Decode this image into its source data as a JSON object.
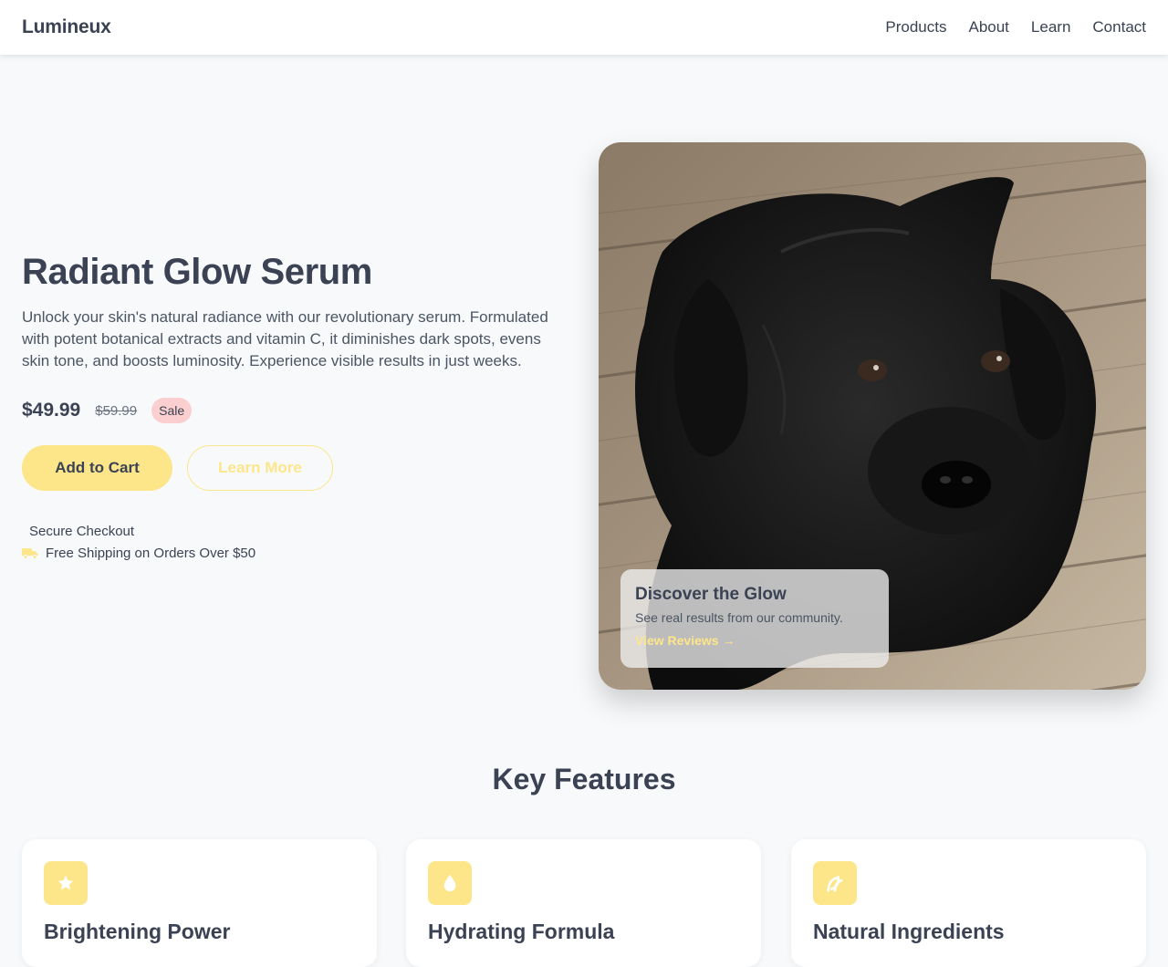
{
  "header": {
    "brand": "Lumineux",
    "nav": [
      "Products",
      "About",
      "Learn",
      "Contact"
    ]
  },
  "hero": {
    "title": "Radiant Glow Serum",
    "description": "Unlock your skin's natural radiance with our revolutionary serum. Formulated with potent botanical extracts and vitamin C, it diminishes dark spots, evens skin tone, and boosts luminosity. Experience visible results in just weeks.",
    "price": "$49.99",
    "old_price": "$59.99",
    "badge": "Sale",
    "add_to_cart": "Add to Cart",
    "learn_more": "Learn More",
    "perks": [
      "Secure Checkout",
      "Free Shipping on Orders Over $50"
    ],
    "image_overlay": {
      "title": "Discover the Glow",
      "text": "See real results from our community.",
      "link": "View Reviews →"
    }
  },
  "features": {
    "title": "Key Features",
    "items": [
      {
        "icon": "star-icon",
        "title": "Brightening Power"
      },
      {
        "icon": "droplet-icon",
        "title": "Hydrating Formula"
      },
      {
        "icon": "leaf-icon",
        "title": "Natural Ingredients"
      }
    ]
  },
  "colors": {
    "accent": "#fde68a",
    "text": "#3a4253",
    "sale_badge": "#fbcfd0",
    "background": "#f7f9fb"
  }
}
